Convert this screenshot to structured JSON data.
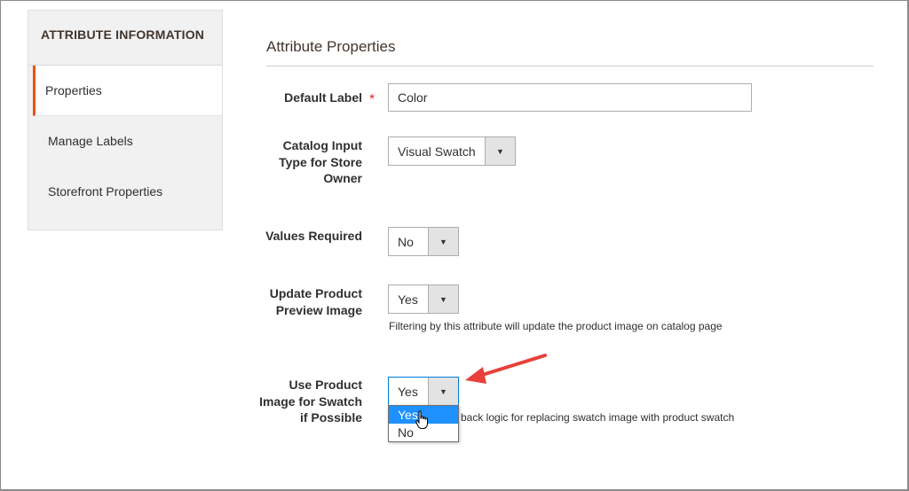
{
  "sidebar": {
    "title": "ATTRIBUTE INFORMATION",
    "items": [
      {
        "label": "Properties",
        "active": true
      },
      {
        "label": "Manage Labels",
        "active": false
      },
      {
        "label": "Storefront Properties",
        "active": false
      }
    ]
  },
  "main": {
    "section_title": "Attribute Properties",
    "fields": {
      "default_label": {
        "label": "Default Label",
        "value": "Color",
        "required_mark": "*"
      },
      "catalog_input_type": {
        "label": "Catalog Input Type for Store Owner",
        "value": "Visual Swatch"
      },
      "values_required": {
        "label": "Values Required",
        "value": "No"
      },
      "update_preview_image": {
        "label": "Update Product Preview Image",
        "value": "Yes",
        "note": "Filtering by this attribute will update the product image on catalog page"
      },
      "use_product_image": {
        "label": "Use Product Image for Swatch if Possible",
        "value": "Yes",
        "note_visible": "back logic for replacing swatch image with product swatch",
        "options": [
          "Yes",
          "No"
        ],
        "highlighted_option": "Yes"
      }
    }
  },
  "icons": {
    "dropdown_arrow": "triangle-down-icon",
    "cursor": "hand-pointer-icon",
    "annotation": "red-arrow-icon"
  },
  "colors": {
    "accent": "#eb5202",
    "required": "#e22626",
    "highlight": "#1e90ff",
    "annotation_arrow": "#e8403a"
  }
}
